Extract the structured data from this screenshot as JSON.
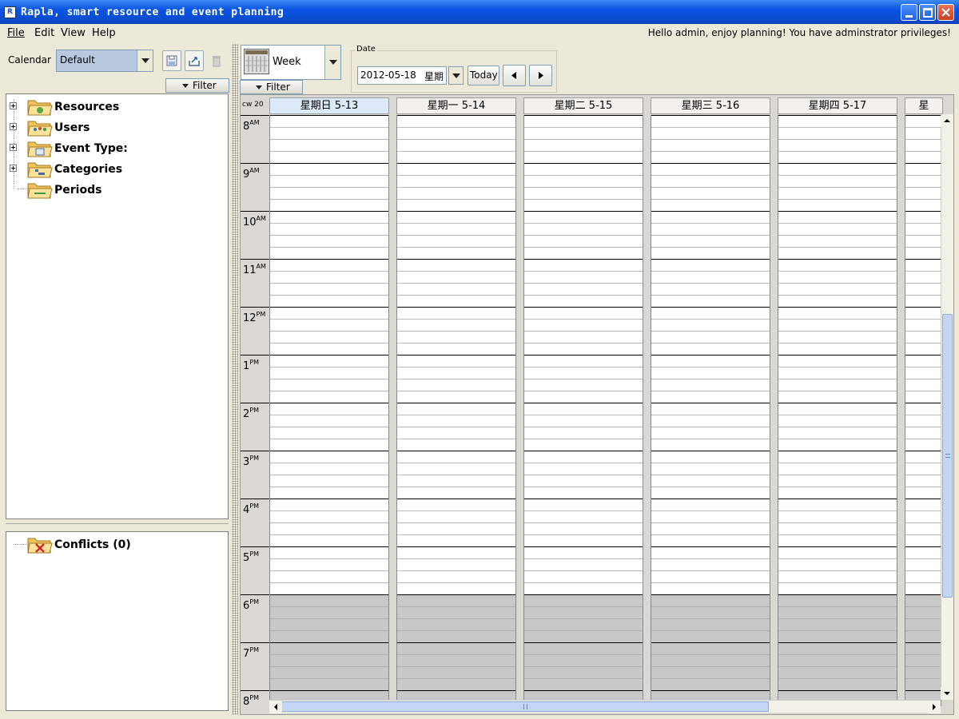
{
  "window": {
    "title": "Rapla, smart resource and event planning",
    "app_icon": "R"
  },
  "menubar": {
    "items": [
      "File",
      "Edit",
      "View",
      "Help"
    ],
    "greeting": "Hello admin, enjoy planning! You have adminstrator privileges!"
  },
  "left": {
    "calendar_label": "Calendar",
    "calendar_value": "Default",
    "filter_label": "Filter",
    "tree": [
      "Resources",
      "Users",
      "Event Type:",
      "Categories",
      "Periods"
    ],
    "conflicts": "Conflicts (0)"
  },
  "toolbar": {
    "view": "Week",
    "filter_label": "Filter",
    "date_legend": "Date",
    "date_value": "2012-05-18",
    "weekday_value": "星期",
    "today_label": "Today"
  },
  "calendar": {
    "week_label": "cw 20",
    "days": [
      "星期日 5-13",
      "星期一 5-14",
      "星期二 5-15",
      "星期三 5-16",
      "星期四 5-17",
      "星"
    ],
    "hours": [
      {
        "h": "8",
        "ap": "AM"
      },
      {
        "h": "9",
        "ap": "AM"
      },
      {
        "h": "10",
        "ap": "AM"
      },
      {
        "h": "11",
        "ap": "AM"
      },
      {
        "h": "12",
        "ap": "PM"
      },
      {
        "h": "1",
        "ap": "PM"
      },
      {
        "h": "2",
        "ap": "PM"
      },
      {
        "h": "3",
        "ap": "PM"
      },
      {
        "h": "4",
        "ap": "PM"
      },
      {
        "h": "5",
        "ap": "PM"
      },
      {
        "h": "6",
        "ap": "PM"
      },
      {
        "h": "7",
        "ap": "PM"
      },
      {
        "h": "8",
        "ap": "PM"
      }
    ]
  },
  "colors": {
    "titlebar": "#0a55e4",
    "today_header": "#dbe9f8",
    "off_hours": "#c8c8c8",
    "workspace": "#ece9d8"
  }
}
